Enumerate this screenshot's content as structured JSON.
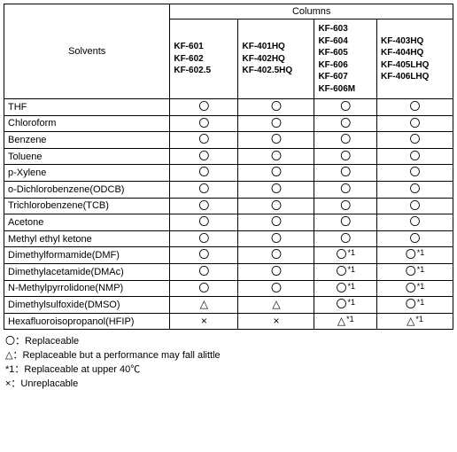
{
  "headers": {
    "solvents": "Solvents",
    "columns": "Columns"
  },
  "column_groups": [
    "KF-601\nKF-602\nKF-602.5",
    "KF-401HQ\nKF-402HQ\nKF-402.5HQ",
    "KF-603\nKF-604\nKF-605\nKF-606\nKF-607\nKF-606M",
    "KF-403HQ\nKF-404HQ\nKF-405LHQ\nKF-406LHQ"
  ],
  "solvents": [
    "THF",
    "Chloroform",
    "Benzene",
    "Toluene",
    "p-Xylene",
    "o-Dichlorobenzene(ODCB)",
    "Trichlorobenzene(TCB)",
    "Acetone",
    "Methyl ethyl ketone",
    "Dimethylformamide(DMF)",
    "Dimethylacetamide(DMAc)",
    "N-Methylpyrrolidone(NMP)",
    "Dimethylsulfoxide(DMSO)",
    "Hexafluoroisopropanol(HFIP)"
  ],
  "symbols": {
    "O": "〇",
    "T": "△",
    "X": "×"
  },
  "note1": "*1",
  "chart_data": {
    "type": "table",
    "title": "Solvent compatibility by column",
    "columns": [
      "KF-601/602/602.5",
      "KF-401HQ/402HQ/402.5HQ",
      "KF-603/604/605/606/607/606M",
      "KF-403HQ/404HQ/405LHQ/406LHQ"
    ],
    "rows": [
      {
        "solvent": "THF",
        "values": [
          "O",
          "O",
          "O",
          "O"
        ]
      },
      {
        "solvent": "Chloroform",
        "values": [
          "O",
          "O",
          "O",
          "O"
        ]
      },
      {
        "solvent": "Benzene",
        "values": [
          "O",
          "O",
          "O",
          "O"
        ]
      },
      {
        "solvent": "Toluene",
        "values": [
          "O",
          "O",
          "O",
          "O"
        ]
      },
      {
        "solvent": "p-Xylene",
        "values": [
          "O",
          "O",
          "O",
          "O"
        ]
      },
      {
        "solvent": "o-Dichlorobenzene(ODCB)",
        "values": [
          "O",
          "O",
          "O",
          "O"
        ]
      },
      {
        "solvent": "Trichlorobenzene(TCB)",
        "values": [
          "O",
          "O",
          "O",
          "O"
        ]
      },
      {
        "solvent": "Acetone",
        "values": [
          "O",
          "O",
          "O",
          "O"
        ]
      },
      {
        "solvent": "Methyl ethyl ketone",
        "values": [
          "O",
          "O",
          "O",
          "O"
        ]
      },
      {
        "solvent": "Dimethylformamide(DMF)",
        "values": [
          "O",
          "O",
          "O*1",
          "O*1"
        ]
      },
      {
        "solvent": "Dimethylacetamide(DMAc)",
        "values": [
          "O",
          "O",
          "O*1",
          "O*1"
        ]
      },
      {
        "solvent": "N-Methylpyrrolidone(NMP)",
        "values": [
          "O",
          "O",
          "O*1",
          "O*1"
        ]
      },
      {
        "solvent": "Dimethylsulfoxide(DMSO)",
        "values": [
          "T",
          "T",
          "O*1",
          "O*1"
        ]
      },
      {
        "solvent": "Hexafluoroisopropanol(HFIP)",
        "values": [
          "X",
          "X",
          "T*1",
          "T*1"
        ]
      }
    ],
    "legend": {
      "O": "Replaceable",
      "T": "Replaceable but a performance may fall a little",
      "*1": "Replaceable at upper 40℃",
      "X": "Unreplacable"
    }
  },
  "legend_lines": [
    "〇：Replaceable",
    "△：Replaceable but a performance may fall alittle",
    "*1：Replaceable at upper 40℃",
    "×：Unreplacable"
  ]
}
